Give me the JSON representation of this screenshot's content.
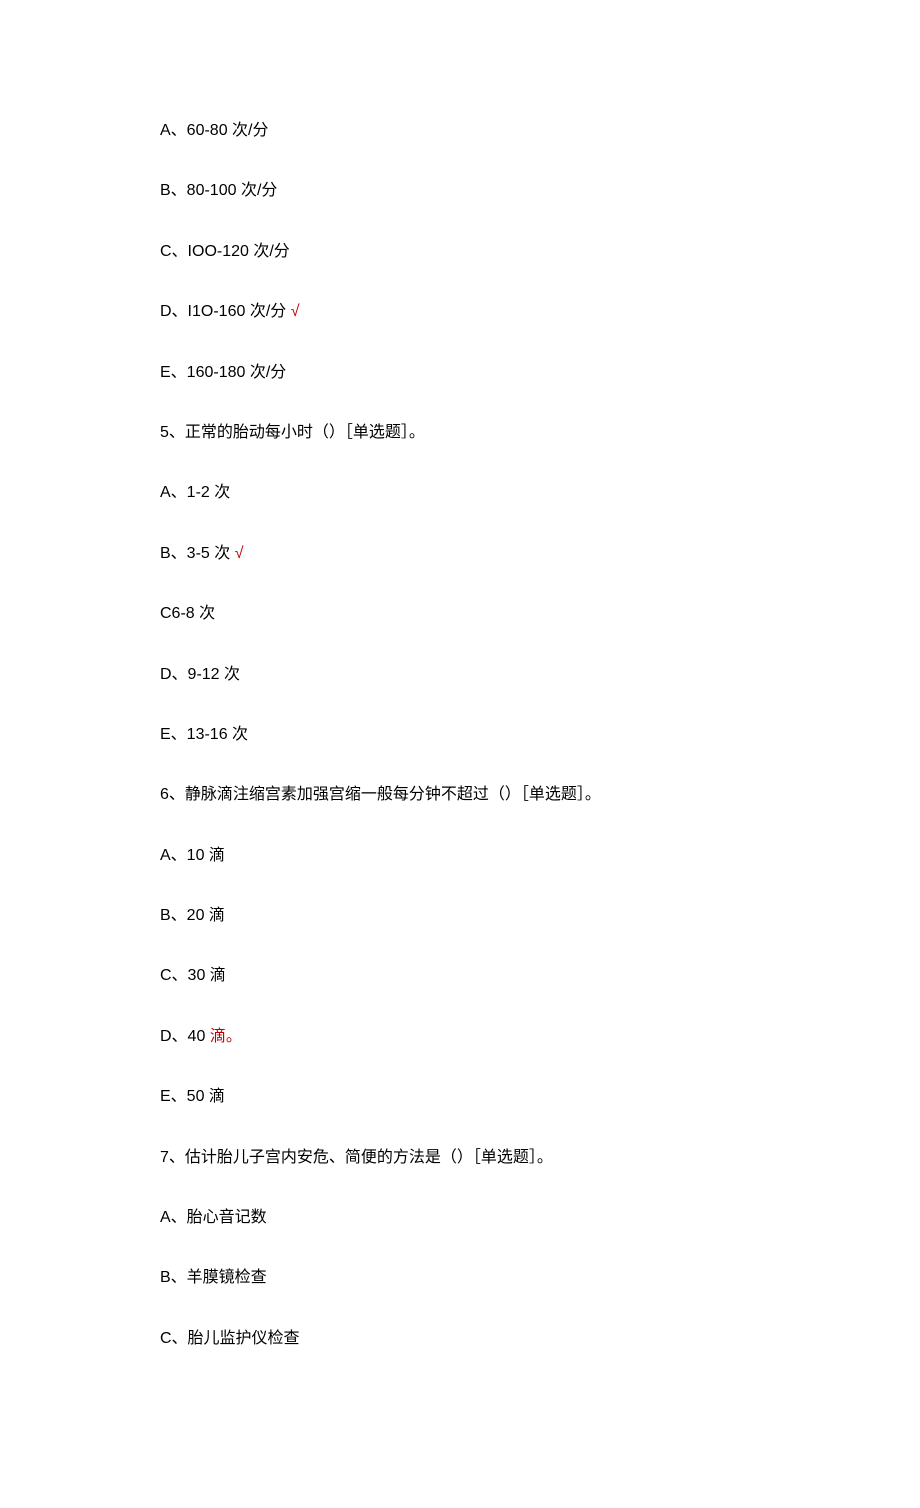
{
  "lines": [
    {
      "text": "A、60-80 次/分",
      "check": false
    },
    {
      "text": "B、80-100 次/分",
      "check": false
    },
    {
      "text": "C、IOO-120 次/分",
      "check": false
    },
    {
      "text": "D、I1O-160 次/分 ",
      "check": true
    },
    {
      "text": "E、160-180 次/分",
      "check": false
    },
    {
      "text": "5、正常的胎动每小时（）［单选题］。",
      "check": false
    },
    {
      "text": "A、1-2 次",
      "check": false
    },
    {
      "text": "B、3-5 次 ",
      "check": true
    },
    {
      "text": "C6-8 次",
      "check": false
    },
    {
      "text": "D、9-12 次",
      "check": false
    },
    {
      "text": "E、13-16 次",
      "check": false
    },
    {
      "text": "6、静脉滴注缩宫素加强宫缩一般每分钟不超过（）［单选题］。",
      "check": false
    },
    {
      "text": "A、10 滴",
      "check": false
    },
    {
      "text": "B、20 滴",
      "check": false
    },
    {
      "text": "C、30 滴",
      "check": false
    },
    {
      "prefix": "D、40 ",
      "highlight": "滴。",
      "check": false
    },
    {
      "text": "E、50 滴",
      "check": false
    },
    {
      "text": "7、估计胎儿子宫内安危、简便的方法是（）［单选题］。",
      "check": false
    },
    {
      "text": "A、胎心音记数",
      "check": false
    },
    {
      "text": "B、羊膜镜检查",
      "check": false
    },
    {
      "text": "C、胎儿监护仪检查",
      "check": false
    }
  ],
  "check_symbol": "√"
}
